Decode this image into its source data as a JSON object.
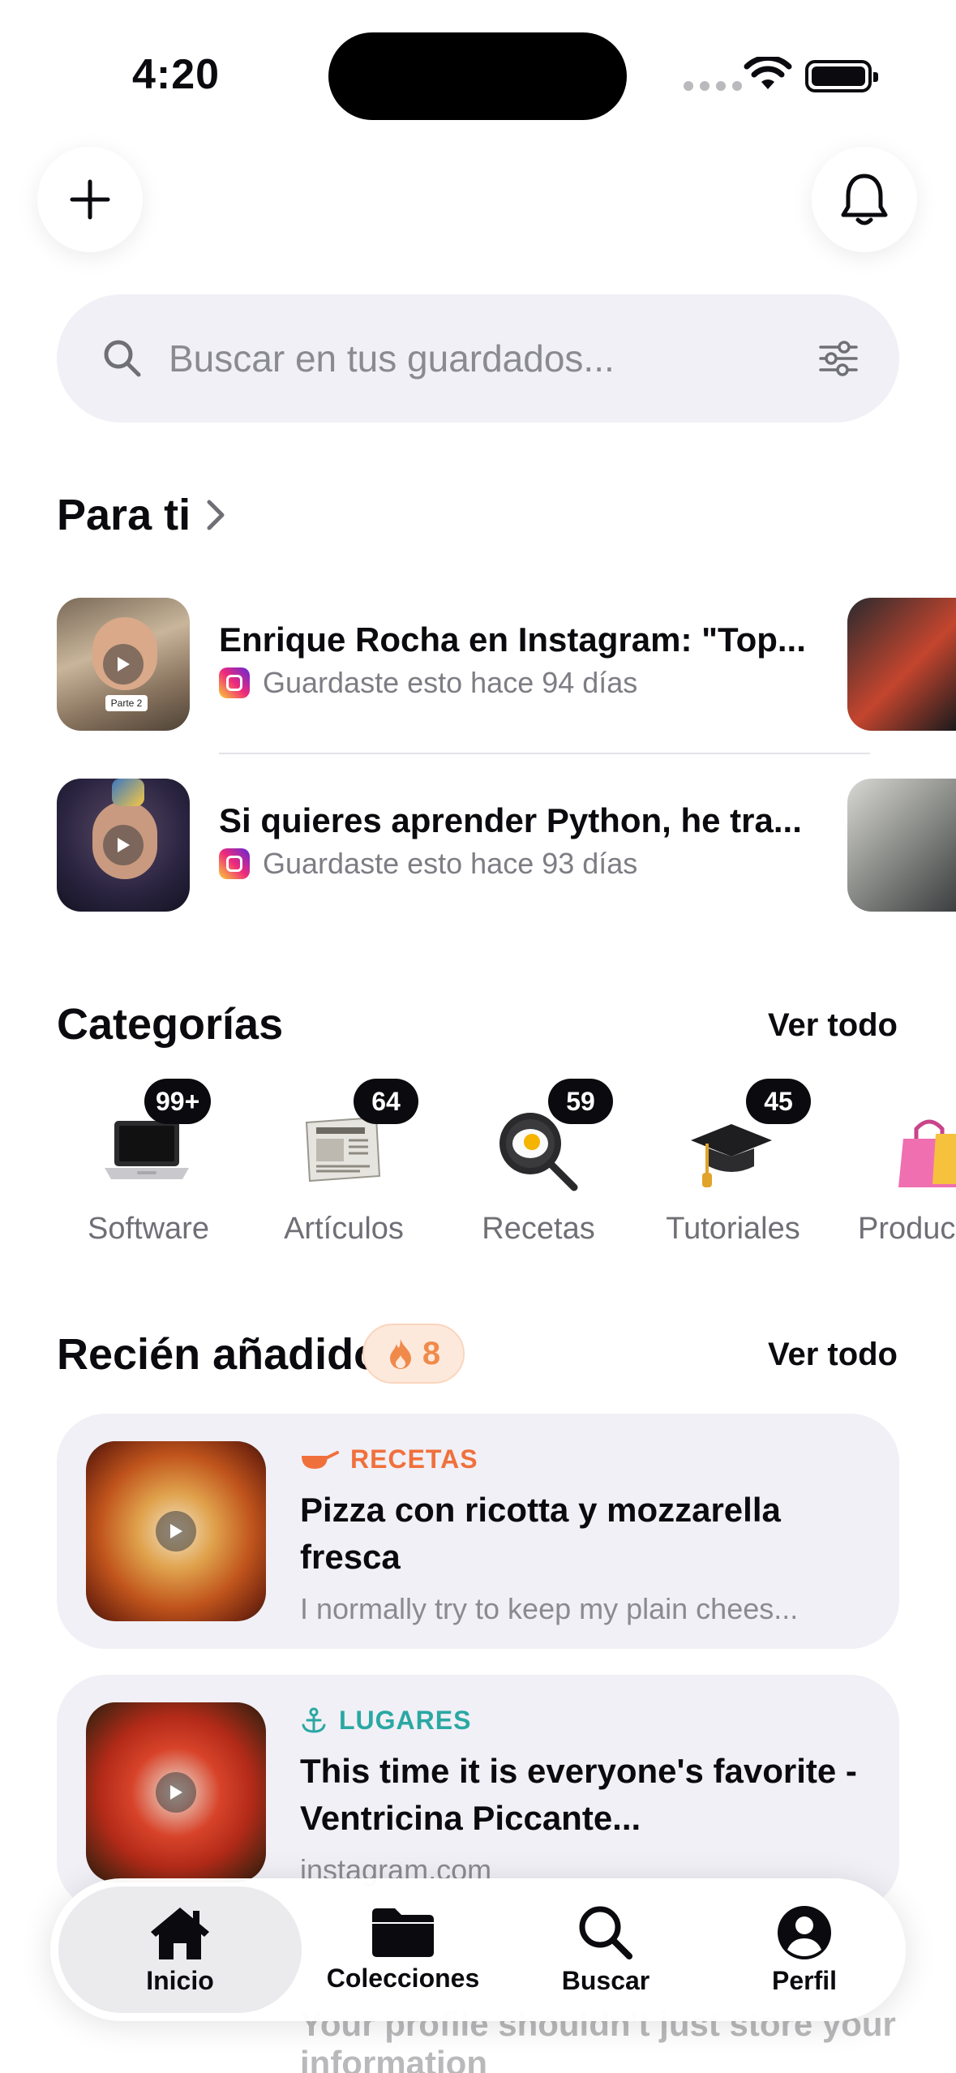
{
  "status_bar": {
    "time": "4:20"
  },
  "search": {
    "placeholder": "Buscar en tus guardados..."
  },
  "para_ti": {
    "title": "Para ti",
    "items": [
      {
        "title": "Enrique Rocha en Instagram: \"Top...",
        "meta": "Guardaste esto hace 94 días",
        "source_icon": "instagram-icon",
        "thumb_text": "Parte 2"
      },
      {
        "title": "Si quieres aprender Python, he tra...",
        "meta": "Guardaste esto hace 93 días",
        "source_icon": "instagram-icon"
      }
    ]
  },
  "categorias": {
    "title": "Categorías",
    "see_all": "Ver todo",
    "items": [
      {
        "label": "Software",
        "count": "99+",
        "icon": "laptop-icon"
      },
      {
        "label": "Artículos",
        "count": "64",
        "icon": "newspaper-icon"
      },
      {
        "label": "Recetas",
        "count": "59",
        "icon": "frying-pan-icon"
      },
      {
        "label": "Tutoriales",
        "count": "45",
        "icon": "graduation-cap-icon"
      },
      {
        "label": "Produc",
        "count": "",
        "icon": "shopping-bags-icon"
      }
    ]
  },
  "recien": {
    "title": "Recién añadido",
    "count": "8",
    "see_all": "Ver todo",
    "cards": [
      {
        "category": "RECETAS",
        "category_color": "#f0703c",
        "title": "Pizza con ricotta y mozzarella fresca",
        "desc": "I normally try to keep my plain chees..."
      },
      {
        "category": "LUGARES",
        "category_color": "#2aa8a3",
        "title": "This time it is everyone's favorite - Ventricina Piccante...",
        "desc": "instagram.com"
      }
    ],
    "partial_text": "Your profile shouldn't just store your information"
  },
  "tabbar": {
    "tabs": [
      {
        "label": "Inicio",
        "icon": "home-icon",
        "active": true
      },
      {
        "label": "Colecciones",
        "icon": "folder-icon",
        "active": false
      },
      {
        "label": "Buscar",
        "icon": "search-icon",
        "active": false
      },
      {
        "label": "Perfil",
        "icon": "profile-icon",
        "active": false
      }
    ]
  }
}
